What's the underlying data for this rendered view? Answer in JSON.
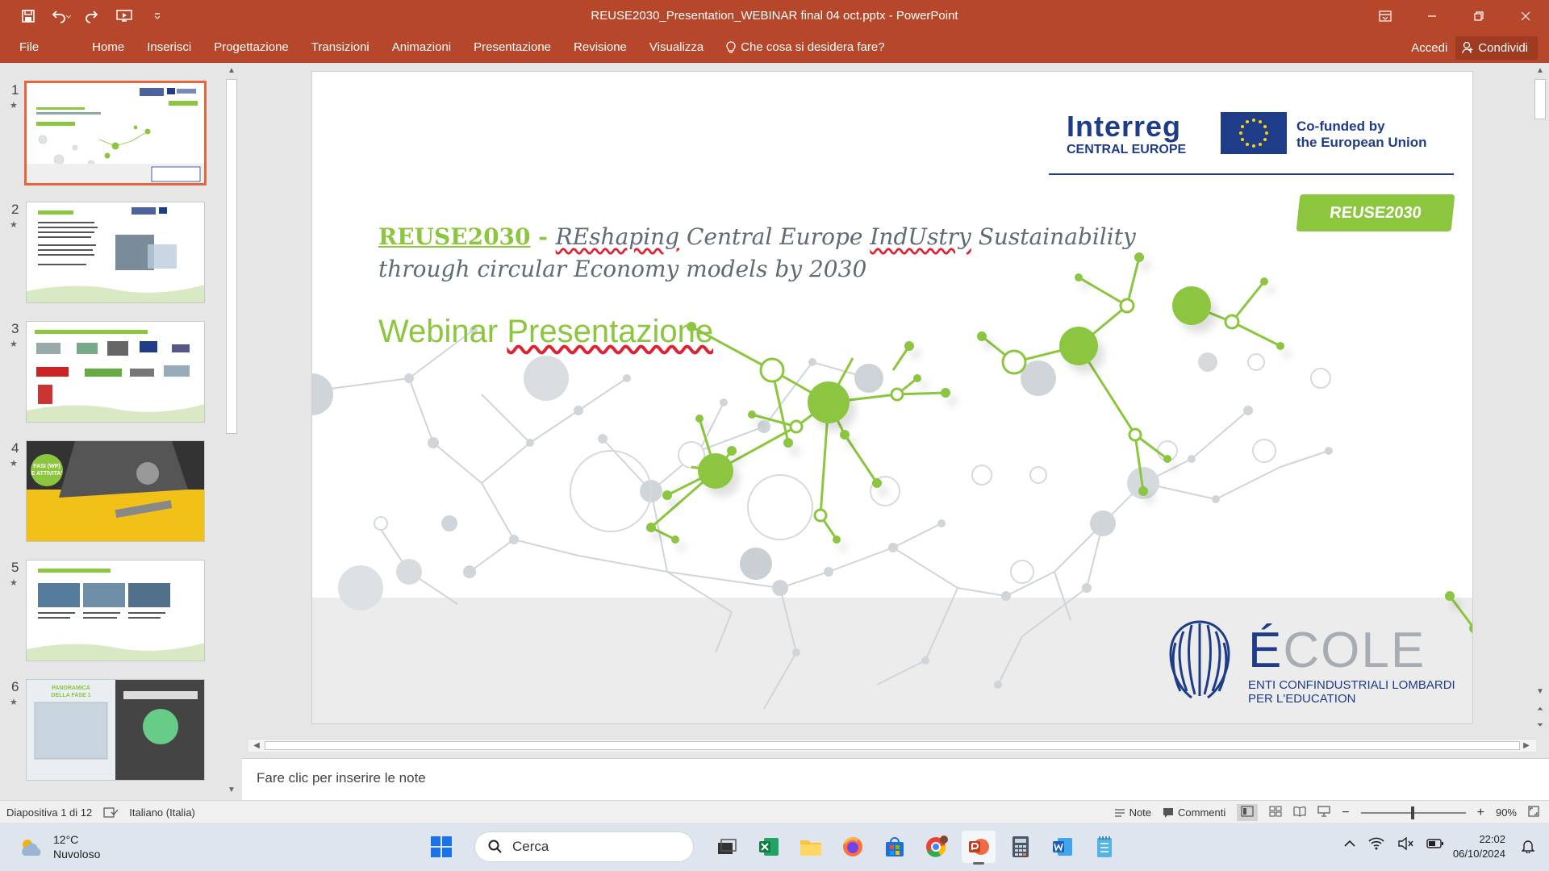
{
  "window": {
    "title": "REUSE2030_Presentation_WEBINAR final 04 oct.pptx - PowerPoint",
    "qat_icons": [
      "save-icon",
      "undo-icon",
      "redo-icon",
      "start-from-beginning-icon",
      "customize-qat-icon"
    ],
    "controls": [
      "ribbon-display-options-icon",
      "minimize-icon",
      "restore-icon",
      "close-icon"
    ]
  },
  "ribbon": {
    "tabs": [
      "File",
      "Home",
      "Inserisci",
      "Progettazione",
      "Transizioni",
      "Animazioni",
      "Presentazione",
      "Revisione",
      "Visualizza"
    ],
    "tell_me": "Che cosa si desidera fare?",
    "signin": "Accedi",
    "share": "Condividi"
  },
  "thumbnails": [
    {
      "number": "1",
      "title": "REUSE2030 - REshaping Central Europe IndUstry Sustainability",
      "selected": true
    },
    {
      "number": "2",
      "title": "IL PROGETTO",
      "selected": false
    },
    {
      "number": "3",
      "title": "PARTNERSHIP: 10 ORGANIZZAZIONI, 9 PAESI CE",
      "selected": false
    },
    {
      "number": "4",
      "title": "FASI (WP) E ATTIVITA'",
      "selected": false
    },
    {
      "number": "5",
      "title": "LE FASI (WORK PACKAGES)",
      "selected": false
    },
    {
      "number": "6",
      "title": "PANORAMICA DELLA FASE 1",
      "selected": false
    }
  ],
  "slide": {
    "brand": "REUSE2030",
    "dash": " - ",
    "title_w1": "REshaping",
    "title_w2": " Central Europe ",
    "title_w3": "IndUstry",
    "title_w4": " Sustainability",
    "title_line2": "through circular Economy models by 2030",
    "subtitle_a": "Webinar ",
    "subtitle_b": "Presentazione",
    "badge": "REUSE2030",
    "interreg_big": "Interreg",
    "interreg_small": "CENTRAL EUROPE",
    "eu_line1": "Co-funded by",
    "eu_line2": "the European Union",
    "ecole_e": "É",
    "ecole_rest": "COLE",
    "ecole_sub1": "ENTI CONFINDUSTRIALI LOMBARDI",
    "ecole_sub2": "PER L'EDUCATION",
    "colors": {
      "green": "#8cc63f",
      "grey": "#5e6b73",
      "navy": "#1f3c88"
    }
  },
  "notes": {
    "placeholder": "Fare clic per inserire le note"
  },
  "status": {
    "slide_counter": "Diapositiva 1 di 12",
    "language": "Italiano (Italia)",
    "notes": "Note",
    "comments": "Commenti",
    "zoom": "90%"
  },
  "taskbar": {
    "temperature": "12°C",
    "weather": "Nuvoloso",
    "search": "Cerca",
    "apps": [
      "windows-start-icon",
      "task-view-icon",
      "excel-icon",
      "file-explorer-icon",
      "firefox-icon",
      "microsoft-store-icon",
      "chrome-icon",
      "powerpoint-icon",
      "calculator-icon",
      "word-icon",
      "notepad-icon"
    ],
    "time": "22:02",
    "date": "06/10/2024"
  }
}
